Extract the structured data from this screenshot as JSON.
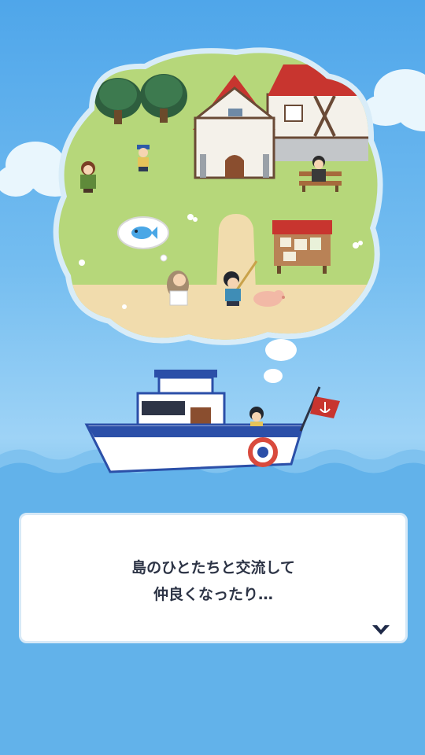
{
  "dialog": {
    "line1": "島のひとたちと交流して",
    "line2": "仲良くなったり…"
  },
  "icons": {
    "next": "chevron-down-icon",
    "thought_fish": "fish-icon",
    "flag": "anchor-icon"
  },
  "colors": {
    "sky_top": "#4fa6ea",
    "sea": "#5fb0ea",
    "grass": "#b6d77a",
    "sand": "#f1dcad",
    "roof": "#c8352f",
    "boat_blue": "#2b4fa8",
    "dialog_text": "#2d3446"
  }
}
